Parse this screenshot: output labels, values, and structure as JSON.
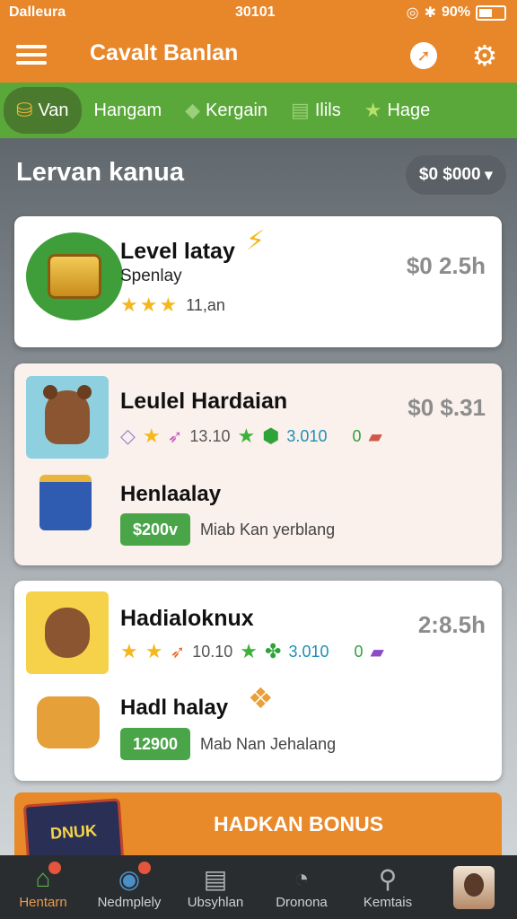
{
  "status": {
    "carrier": "Dalleura",
    "time": "30101",
    "battery": "90%"
  },
  "app": {
    "title": "Cavalt Banlan",
    "compass_icon": "compass-icon",
    "settings_icon": "gear-icon"
  },
  "tabs": [
    {
      "label": "Van",
      "icon": "coins-icon",
      "active": true
    },
    {
      "label": "Hangam",
      "icon": "none"
    },
    {
      "label": "Kergain",
      "icon": "tag-icon"
    },
    {
      "label": "Ilils",
      "icon": "chart-icon"
    },
    {
      "label": "Hage",
      "icon": "star-icon"
    }
  ],
  "section": {
    "title": "Lervan kanua",
    "balance": "$0 $000"
  },
  "cards": [
    {
      "title": "Level latay",
      "subtitle": "Spenlay",
      "rating_text": "11,an",
      "price": "$0 2.5h"
    },
    {
      "title": "Leulel Hardaian",
      "price": "$0 $.31",
      "stat1": "13.10",
      "stat2": "3.010",
      "stat3": "0",
      "sub_title": "Henlaalay",
      "badge": "$200v",
      "link": "Miab Kan yerblang"
    },
    {
      "title": "Hadialoknux",
      "price": "2:8.5h",
      "stat1": "10.10",
      "stat2": "3.010",
      "stat3": "0",
      "sub_title": "Hadl halay",
      "badge": "12900",
      "link": "Mab Nan Jehalang"
    }
  ],
  "bonus": {
    "label": "HADKAN BONUS",
    "image_text": "DNUK"
  },
  "nav": [
    {
      "label": "Hentarn",
      "icon": "home-icon",
      "active": true
    },
    {
      "label": "Nedmplely",
      "icon": "profile-icon"
    },
    {
      "label": "Ubsyhlan",
      "icon": "inbox-icon"
    },
    {
      "label": "Dronona",
      "icon": "chat-icon"
    },
    {
      "label": "Kemtais",
      "icon": "search-icon"
    },
    {
      "label": "",
      "icon": "avatar"
    }
  ]
}
